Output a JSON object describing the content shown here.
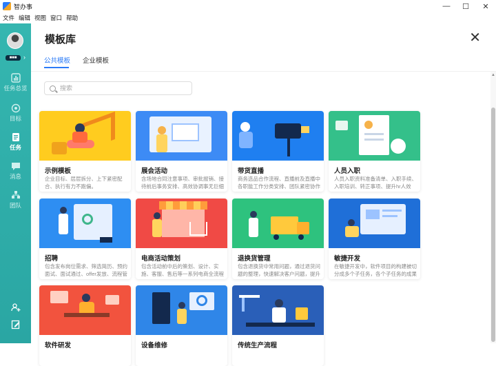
{
  "window": {
    "title": "智办事",
    "controls": {
      "minimize": "—",
      "maximize": "☐",
      "close": "✕"
    }
  },
  "menu": [
    "文件",
    "编辑",
    "视图",
    "窗口",
    "帮助"
  ],
  "sidebar": {
    "user_tag": "■■■",
    "items": [
      {
        "label": "任务总览",
        "icon": "overview-icon"
      },
      {
        "label": "目标",
        "icon": "target-icon"
      },
      {
        "label": "任务",
        "icon": "task-icon",
        "active": true
      },
      {
        "label": "消息",
        "icon": "message-icon"
      },
      {
        "label": "团队",
        "icon": "team-icon"
      }
    ],
    "bottom_icons": [
      "add-member-icon",
      "edit-icon"
    ]
  },
  "main": {
    "heading": "模板库",
    "tabs": [
      {
        "label": "公共模板",
        "active": true
      },
      {
        "label": "企业模板",
        "active": false
      }
    ],
    "search": {
      "placeholder": "搜索",
      "value": ""
    }
  },
  "colors": {
    "accent": "#2b7bf7",
    "sidebar": "#2faea9"
  },
  "cards": [
    {
      "title": "示例模板",
      "desc": "企业目标、层层拆分、上下紧密配合、执行有力不跑偏。",
      "bg": "#ffcc1f"
    },
    {
      "title": "展会活动",
      "desc": "含场地合同注意事项、审批报销、接待前后事务安排、高效协调事无巨细",
      "bg": "#3d8bf5"
    },
    {
      "title": "带货直播",
      "desc": "商务选品合作流程、直播前及直播中各职能工作分类安排、团队紧密协作",
      "bg": "#1f7ff0"
    },
    {
      "title": "人员入职",
      "desc": "人员入职资料准备清单、入职手续、入职培训、转正事项、提升hr人效",
      "bg": "#34c08a"
    },
    {
      "title": "招聘",
      "desc": "包含发布岗位需求、筛选简历、预约面试、面试通过、offer发放、流程管理",
      "bg": "#2e8ef2"
    },
    {
      "title": "电商活动策划",
      "desc": "包含活动前中后的策划、设计、实施、客服、售后等一系列电商全流程",
      "bg": "#f04a45"
    },
    {
      "title": "退换货管理",
      "desc": "包含退换货中常用问题，通过退货问题的整理，快速解决客户问题，提升满意",
      "bg": "#2ec27e"
    },
    {
      "title": "敏捷开发",
      "desc": "在敏捷开发中，软件项目的构建被切分成多个子任务，各个子任务的成果",
      "bg": "#1f6fd8"
    },
    {
      "title": "软件研发",
      "desc": "",
      "bg": "#f2533e"
    },
    {
      "title": "设备维修",
      "desc": "",
      "bg": "#2f86e8"
    },
    {
      "title": "传统生产流程",
      "desc": "",
      "bg": "#2a5fb8"
    }
  ]
}
